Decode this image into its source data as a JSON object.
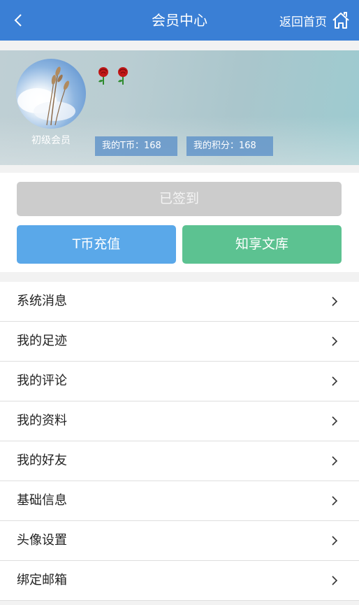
{
  "header": {
    "title": "会员中心",
    "home_label": "返回首页",
    "icons": {
      "back": "chevron-left-icon",
      "home": "home-icon"
    }
  },
  "profile": {
    "level": "初级会员",
    "badges": [
      "rose-icon",
      "rose-icon"
    ],
    "t_coin_label": "我的T币：168",
    "points_label": "我的积分：168"
  },
  "actions": {
    "checkin_label": "已签到",
    "recharge_label": "T币充值",
    "library_label": "知享文库"
  },
  "menu": {
    "items": [
      {
        "label": "系统消息"
      },
      {
        "label": "我的足迹"
      },
      {
        "label": "我的评论"
      },
      {
        "label": "我的资料"
      },
      {
        "label": "我的好友"
      },
      {
        "label": "基础信息"
      },
      {
        "label": "头像设置"
      },
      {
        "label": "绑定邮箱"
      }
    ]
  },
  "colors": {
    "header": "#3a7fd5",
    "checkin_disabled": "#cccccc",
    "recharge": "#5aa8e9",
    "library": "#5cc291",
    "stat_badge": "#5b8fc8"
  }
}
